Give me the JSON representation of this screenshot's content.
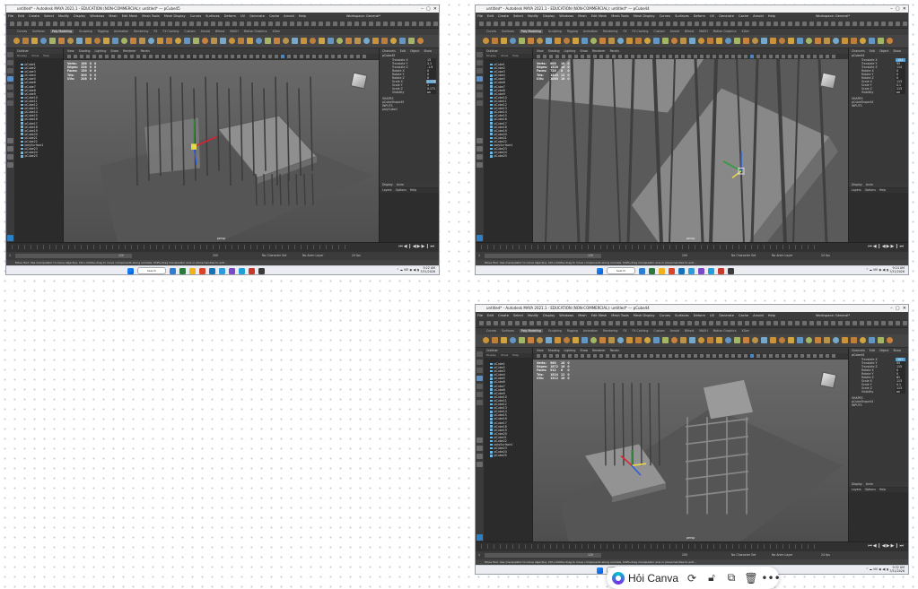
{
  "screens": [
    {
      "title": "untitled* - Autodesk MAYA 2021.1 - EDUCATION (NON-COMMERCIAL): untitled* --- pCube45",
      "selected_object": "pCube45",
      "hud": {
        "verts": [
          "Verts:",
          "188",
          "0",
          "0"
        ],
        "edges": [
          "Edges:",
          "336",
          "0",
          "0"
        ],
        "faces": [
          "Faces:",
          "150",
          "0",
          "0"
        ],
        "tris": [
          "Tris:",
          "300",
          "0",
          "0"
        ],
        "uvs": [
          "UVs:",
          "208",
          "0",
          "0"
        ]
      },
      "channels": [
        [
          "Translate X",
          "13"
        ],
        [
          "Translate Y",
          "2.1"
        ],
        [
          "Translate Z",
          "-1.9"
        ],
        [
          "Rotate X",
          "0"
        ],
        [
          "Rotate Y",
          "0"
        ],
        [
          "Rotate Z",
          "0"
        ],
        [
          "Scale X",
          "0.174"
        ],
        [
          "Scale Y",
          "1"
        ],
        [
          "Scale Z",
          "0.171"
        ],
        [
          "Visibility",
          "on"
        ]
      ],
      "selected_channel_index": 6,
      "shape_name": "pCubeShape45",
      "inputs": "polyCube1",
      "time": "9:22 AM",
      "date": "7/31/2026",
      "taskbar_status": "12:00"
    },
    {
      "title": "untitled* - Autodesk MAYA 2021.1 - EDUCATION (NON-COMMERCIAL): untitled* --- pCube44",
      "selected_object": "pCube44",
      "hud": {
        "verts": [
          "Verts:",
          "800",
          "16",
          "0"
        ],
        "edges": [
          "Edges:",
          "1520",
          "16",
          "0"
        ],
        "faces": [
          "Faces:",
          "720",
          "6",
          "0"
        ],
        "tris": [
          "Tris:",
          "1440",
          "12",
          "0"
        ],
        "uvs": [
          "UVs:",
          "1060",
          "16",
          "0"
        ]
      },
      "channels": [
        [
          "Translate X",
          "-164"
        ],
        [
          "Translate Y",
          "93"
        ],
        [
          "Translate Z",
          "114"
        ],
        [
          "Rotate X",
          "0"
        ],
        [
          "Rotate Y",
          "0"
        ],
        [
          "Rotate Z",
          "0"
        ],
        [
          "Scale X",
          "113"
        ],
        [
          "Scale Y",
          "0.1"
        ],
        [
          "Scale Z",
          "113"
        ],
        [
          "Visibility",
          "on"
        ]
      ],
      "selected_channel_index": 0,
      "shape_name": "pCubeShape44",
      "inputs": "",
      "time": "9:24 AM",
      "date": "7/31/2026",
      "taskbar_status": ""
    },
    {
      "title": "untitled* - Autodesk MAYA 2021.1 - EDUCATION (NON-COMMERCIAL): untitled* --- pCube44",
      "selected_object": "pCube44",
      "hud": {
        "verts": [
          "Verts:",
          "960",
          "16",
          "0"
        ],
        "edges": [
          "Edges:",
          "1872",
          "16",
          "0"
        ],
        "faces": [
          "Faces:",
          "912",
          "6",
          "0"
        ],
        "tris": [
          "Tris:",
          "1824",
          "12",
          "0"
        ],
        "uvs": [
          "UVs:",
          "1312",
          "16",
          "0"
        ]
      },
      "channels": [
        [
          "Translate X",
          "-163"
        ],
        [
          "Translate Y",
          "93"
        ],
        [
          "Translate Z",
          "115"
        ],
        [
          "Rotate X",
          "0"
        ],
        [
          "Rotate Y",
          "0"
        ],
        [
          "Rotate Z",
          "81"
        ],
        [
          "Scale X",
          "113"
        ],
        [
          "Scale Y",
          "0.1"
        ],
        [
          "Scale Z",
          "113"
        ],
        [
          "Visibility",
          "on"
        ]
      ],
      "selected_channel_index": 0,
      "shape_name": "pCubeShape44",
      "inputs": "",
      "time": "9:32 AM",
      "date": "7/31/2026",
      "taskbar_status": ""
    }
  ],
  "common": {
    "menus": [
      "File",
      "Edit",
      "Create",
      "Select",
      "Modify",
      "Display",
      "Windows",
      "Mesh",
      "Edit Mesh",
      "Mesh Tools",
      "Mesh Display",
      "Curves",
      "Surfaces",
      "Deform",
      "UV",
      "Generate",
      "Cache",
      "Arnold",
      "Help"
    ],
    "workspace_label": "Workspace: General*",
    "shelf_tabs": [
      "Curves",
      "Surfaces",
      "Poly Modeling",
      "Sculpting",
      "Rigging",
      "Animation",
      "Rendering",
      "FX",
      "FX Caching",
      "Custom",
      "Arnold",
      "Bifrost",
      "MASH",
      "Motion Graphics",
      "XGen"
    ],
    "active_shelf_tab": "Poly Modeling",
    "outliner_title": "Outliner",
    "outliner_menu": [
      "Display",
      "Show",
      "Help"
    ],
    "outliner_items": [
      "pCube1",
      "pCube2",
      "pCube3",
      "pCube4",
      "pCube5",
      "pCube6",
      "pCube7",
      "pCube8",
      "pCube9",
      "pCube10",
      "pCube11",
      "pCube12",
      "pCube13",
      "pCube14",
      "pCube15",
      "pCube16",
      "pCube17",
      "pCube18",
      "pCube19",
      "pCube20",
      "pCube21",
      "pCube22",
      "polySurface1",
      "pCube23",
      "pCube24",
      "pCube25"
    ],
    "viewport_menu": [
      "View",
      "Shading",
      "Lighting",
      "Show",
      "Renderer",
      "Panels"
    ],
    "camera_label": "persp",
    "channel_box_menu": [
      "Channels",
      "Edit",
      "Object",
      "Show"
    ],
    "shapes_label": "SHAPES",
    "inputs_label": "INPUTS",
    "layer_tabs": [
      "Display",
      "Anim"
    ],
    "layer_menu": [
      "Layers",
      "Options",
      "Help"
    ],
    "range_start": "1",
    "range_mid": "120",
    "range_end": "200",
    "no_character_set": "No Character Set",
    "no_anim_layer": "No Anim Layer",
    "fps": "24 fps",
    "help_text": "Move Tool: Use manipulator to move object(s). Ctrl+middle-drag to move components along normals. Shift+drag manipulator axis or plane handles to extr...",
    "mel_label": "MEL",
    "search_label": "Search",
    "canva": {
      "label": "Hỏi Canva"
    }
  }
}
